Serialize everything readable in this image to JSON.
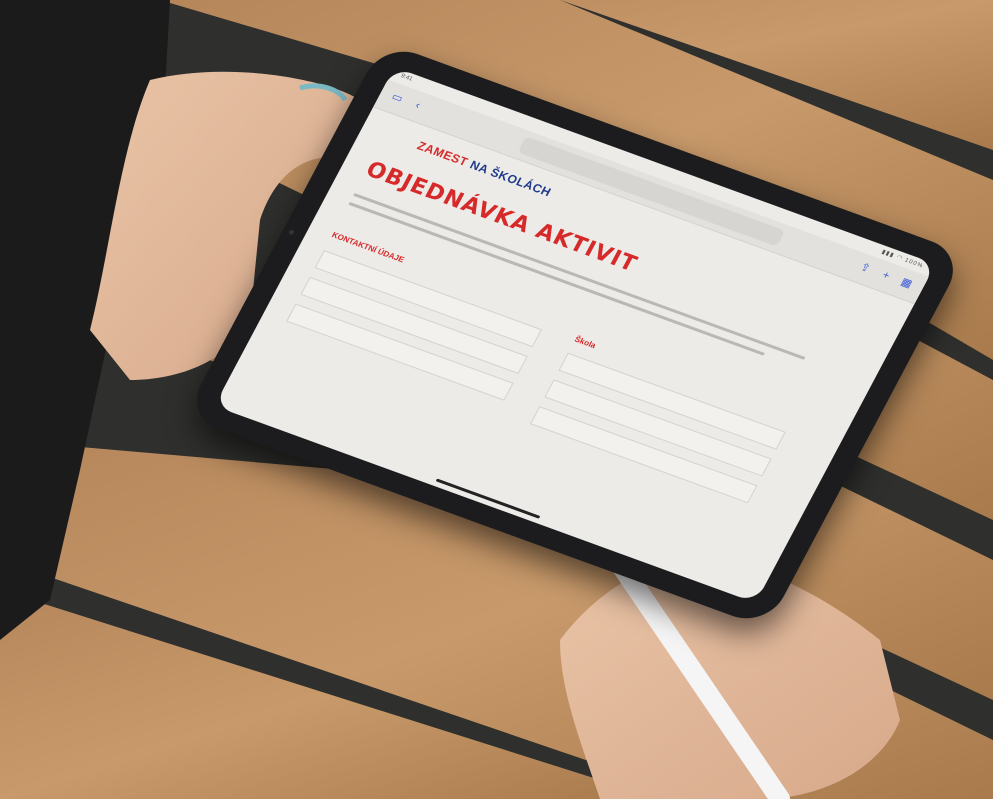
{
  "tablet": {
    "status_time": "9:41",
    "status_icons": "▮▮▮ ◠ 100%",
    "url": "",
    "logo_part1": "ZAMEST",
    "logo_part2": "NA ŠKOLÁCH",
    "title": "OBJEDNÁVKA AKTIVIT",
    "section_personal": "KONTAKTNÍ ÚDAJE",
    "section_school": "Škola"
  },
  "colors": {
    "brand_red": "#d62a2a",
    "brand_blue": "#1f3a8a",
    "ios_accent": "#3a5bd6"
  }
}
